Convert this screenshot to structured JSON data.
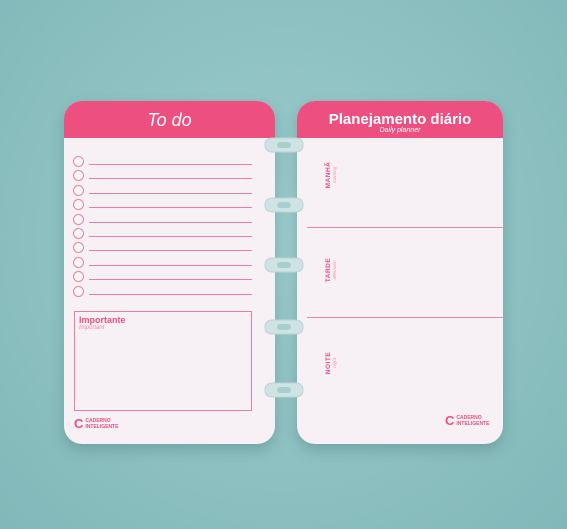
{
  "left_page": {
    "title": "To do",
    "checklist_rows": 10,
    "box_label": "Importante",
    "box_label_en": "Important",
    "logo_line1": "CADERNO",
    "logo_line2": "INTELIGENTE"
  },
  "right_page": {
    "title": "Planejamento diário",
    "subtitle": "Daily planner",
    "sections": [
      {
        "label": "MANHÃ",
        "en": "morning"
      },
      {
        "label": "TARDE",
        "en": "afternoon"
      },
      {
        "label": "NOITE",
        "en": "night"
      }
    ],
    "logo_line1": "CADERNO",
    "logo_line2": "INTELIGENTE"
  },
  "colors": {
    "accent": "#ec4f80",
    "background": "#8fc2c3",
    "paper": "#f7f0f4"
  }
}
